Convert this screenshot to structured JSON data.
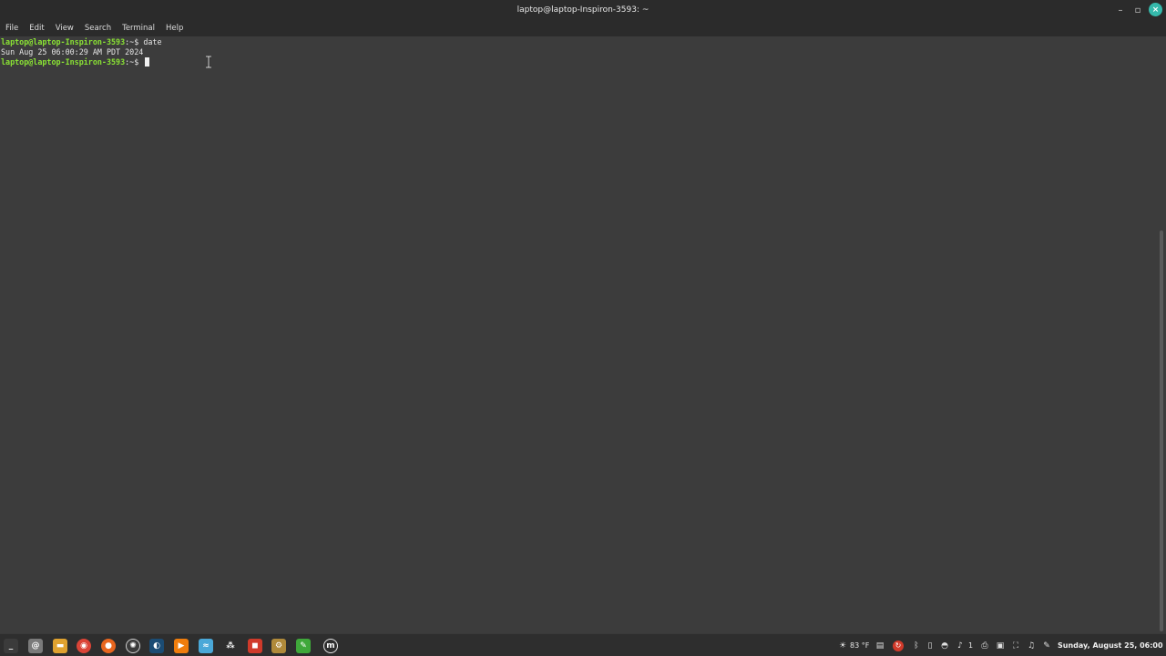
{
  "window": {
    "title": "laptop@laptop-Inspiron-3593: ~",
    "minimize_glyph": "–",
    "maximize_glyph": "▫",
    "close_glyph": "×"
  },
  "menu": {
    "items": [
      "File",
      "Edit",
      "View",
      "Search",
      "Terminal",
      "Help"
    ]
  },
  "terminal": {
    "lines": [
      {
        "prompt_user": "laptop@laptop-Inspiron-3593",
        "prompt_dir": ":~$ ",
        "command": "date"
      },
      {
        "output": "Sun Aug 25 06:00:29 AM PDT 2024"
      },
      {
        "prompt_user": "laptop@laptop-Inspiron-3593",
        "prompt_dir": ":~$ ",
        "command": ""
      }
    ]
  },
  "taskbar": {
    "apps": [
      {
        "name": "terminal-icon",
        "glyph": "_",
        "color": "#3b3b3b",
        "active": true
      },
      {
        "name": "mail-icon",
        "glyph": "@",
        "color": "#7a7a7a",
        "active": false
      },
      {
        "name": "files-icon",
        "glyph": "▬",
        "color": "#e0a22f",
        "active": false
      },
      {
        "name": "chrome-icon",
        "glyph": "◉",
        "color": "#db4437",
        "active": false
      },
      {
        "name": "firefox-icon",
        "glyph": "●",
        "color": "#e8661f",
        "active": false
      },
      {
        "name": "steam-alt-icon",
        "glyph": "✺",
        "color": "#3a3a3a",
        "active": false
      },
      {
        "name": "steam-icon",
        "glyph": "◐",
        "color": "#1b4c74",
        "active": false
      },
      {
        "name": "vlc-icon",
        "glyph": "▶",
        "color": "#f07d0c",
        "active": false
      },
      {
        "name": "dolphin-icon",
        "glyph": "≈",
        "color": "#4aa8d8",
        "active": false
      },
      {
        "name": "dots-icon",
        "glyph": "⁂",
        "color": "#2e2e2e",
        "active": false
      },
      {
        "name": "bag-icon",
        "glyph": "◼",
        "color": "#d03a2a",
        "active": false
      },
      {
        "name": "gears-icon",
        "glyph": "⚙",
        "color": "#b08a3a",
        "active": false
      },
      {
        "name": "pen-icon",
        "glyph": "✎",
        "color": "#3fa83a",
        "active": false
      },
      {
        "name": "mint-logo-icon",
        "glyph": "m",
        "color": "#2e2e2e",
        "active": false
      }
    ]
  },
  "tray": {
    "weather": "83 °F",
    "badge": "1",
    "clock": "Sunday, August 25, 06:00",
    "icons": [
      "sun-icon",
      "clipboard-icon",
      "update-icon",
      "bluetooth-icon",
      "battery-icon",
      "wifi-icon",
      "bell-icon",
      "printer-icon",
      "display-icon",
      "network-icon",
      "music-icon",
      "pen-tray-icon"
    ]
  },
  "colors": {
    "prompt": "#8ae234",
    "terminal_bg": "#3c3c3c",
    "close_button": "#35b9ab",
    "taskbar_active": "#5fb8e6"
  }
}
